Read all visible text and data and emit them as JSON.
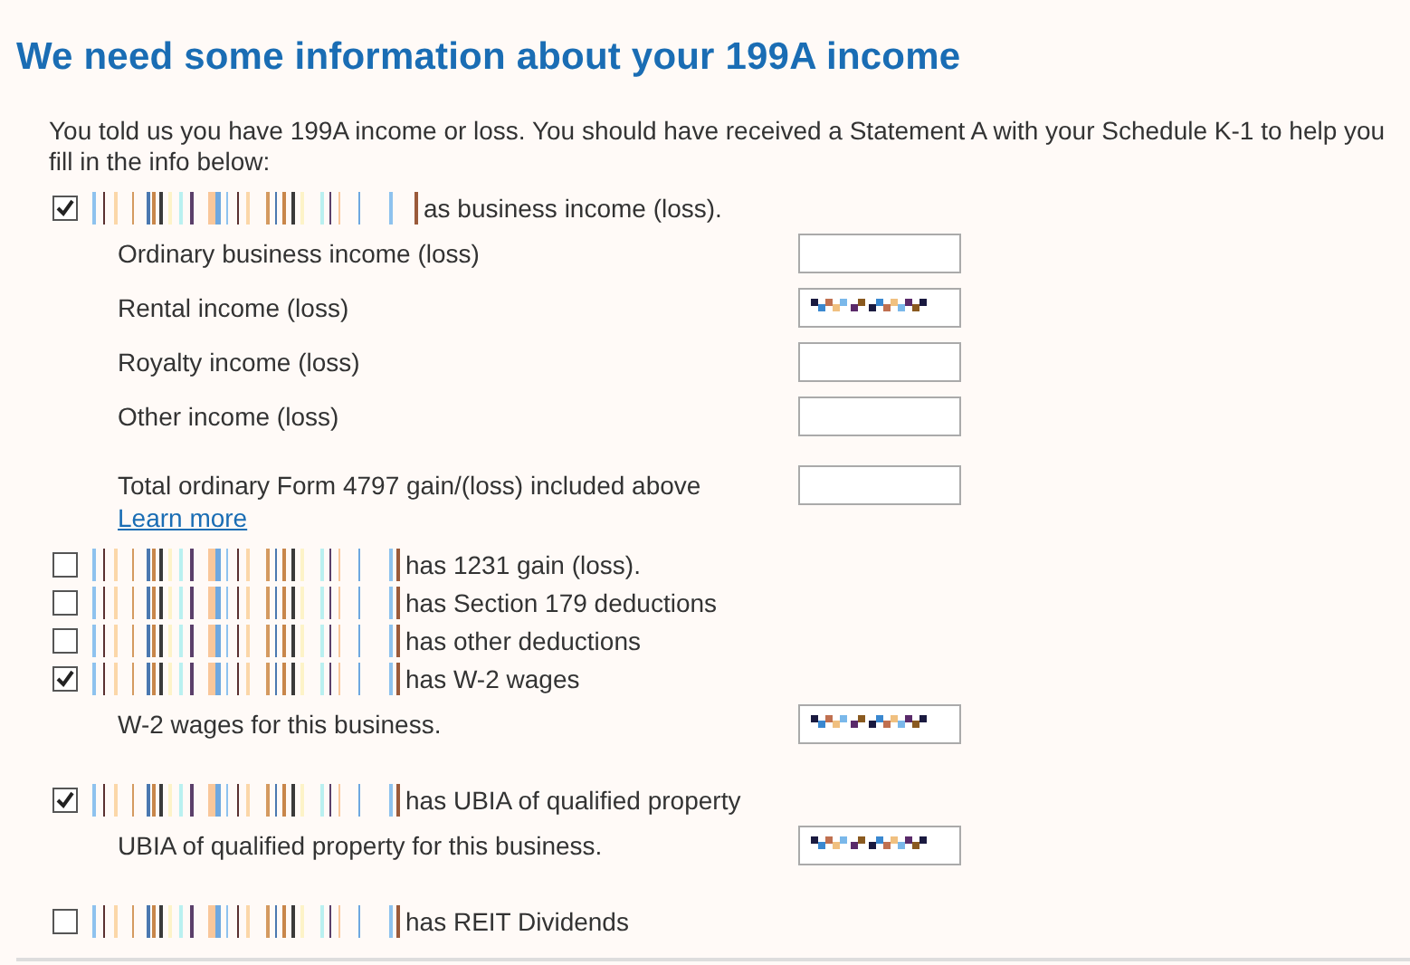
{
  "title": "We need some information about your 199A income",
  "intro": "You told us you have 199A income or loss. You should have received a Statement A with your Schedule K-1 to help you fill in the info below:",
  "items": [
    {
      "checked": true,
      "text": "as business income (loss).",
      "fields": [
        {
          "label": "Ordinary business income (loss)",
          "filled": false
        },
        {
          "label": "Rental income (loss)",
          "filled": true
        },
        {
          "label": "Royalty income (loss)",
          "filled": false
        },
        {
          "label": "Other income (loss)",
          "filled": false
        },
        {
          "label": "Total ordinary Form 4797 gain/(loss) included above",
          "link": "Learn more",
          "filled": false
        }
      ]
    },
    {
      "checked": false,
      "text": "has 1231 gain (loss)."
    },
    {
      "checked": false,
      "text": "has Section 179 deductions"
    },
    {
      "checked": false,
      "text": "has other deductions"
    },
    {
      "checked": true,
      "text": "has W-2 wages",
      "fields": [
        {
          "label": "W-2 wages for this business.",
          "filled": true
        }
      ]
    },
    {
      "checked": true,
      "text": "has UBIA of qualified property",
      "fields": [
        {
          "label": "UBIA of qualified property for this business.",
          "filled": true
        }
      ]
    },
    {
      "checked": false,
      "text": "has REIT Dividends"
    }
  ]
}
